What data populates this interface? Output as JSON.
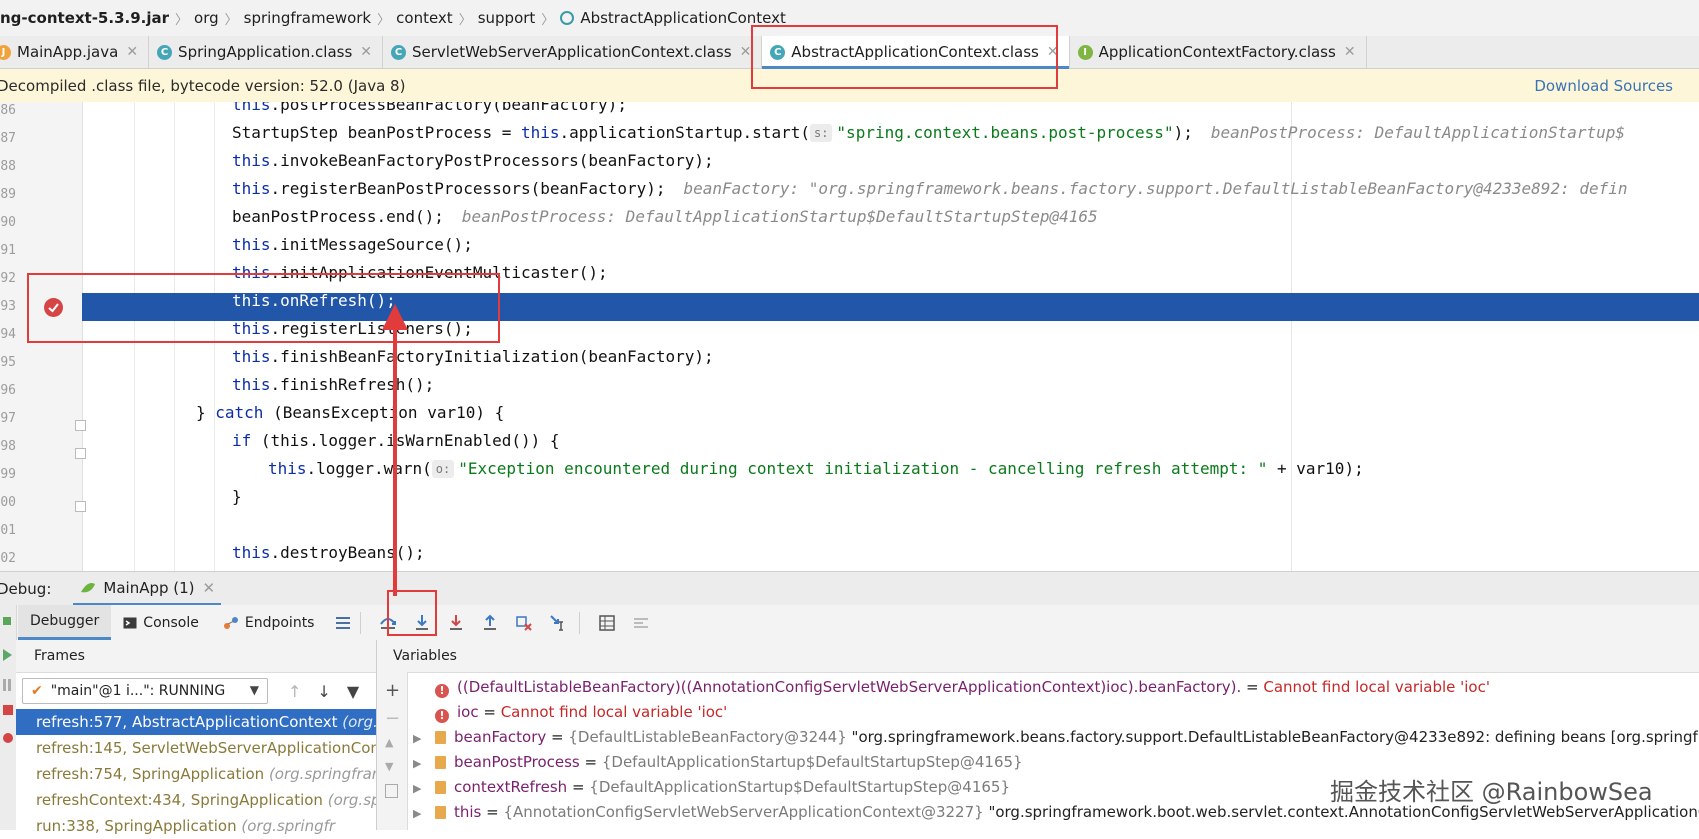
{
  "breadcrumb": {
    "items": [
      "ng-context-5.3.9.jar",
      "org",
      "springframework",
      "context",
      "support",
      "AbstractApplicationContext"
    ]
  },
  "tabs": [
    {
      "label": "MainApp.java",
      "icon": "java-file-icon"
    },
    {
      "label": "SpringApplication.class",
      "icon": "class-file-icon"
    },
    {
      "label": "ServletWebServerApplicationContext.class",
      "icon": "class-file-icon"
    },
    {
      "label": "AbstractApplicationContext.class",
      "icon": "class-file-icon",
      "active": true
    },
    {
      "label": "ApplicationContextFactory.class",
      "icon": "interface-file-icon"
    }
  ],
  "banner": {
    "message": "Decompiled .class file, bytecode version: 52.0 (Java 8)",
    "download": "Download Sources"
  },
  "editor": {
    "line_numbers": [
      "86",
      "87",
      "88",
      "89",
      "90",
      "91",
      "92",
      "93",
      "94",
      "95",
      "96",
      "97",
      "98",
      "99",
      "00",
      "01",
      "02"
    ],
    "lines": [
      {
        "kw": "this",
        "rest": ".postProcessBeanFactory(beanFactory);"
      },
      {
        "pre": "StartupStep beanPostProcess = ",
        "kw": "this",
        "rest": ".applicationStartup.start(",
        "ph": "s:",
        "str": "\"spring.context.beans.post-process\"",
        "post": ");",
        "hint": "beanPostProcess: DefaultApplicationStartup$"
      },
      {
        "kw": "this",
        "rest": ".invokeBeanFactoryPostProcessors(beanFactory);"
      },
      {
        "kw": "this",
        "rest": ".registerBeanPostProcessors(beanFactory);",
        "hint": "beanFactory: \"org.springframework.beans.factory.support.DefaultListableBeanFactory@4233e892: defin"
      },
      {
        "pre": "beanPostProcess.end();",
        "hint": "beanPostProcess: DefaultApplicationStartup$DefaultStartupStep@4165"
      },
      {
        "kw": "this",
        "rest": ".initMessageSource();"
      },
      {
        "kw": "this",
        "rest": ".initApplicationEventMulticaster();"
      },
      {
        "kw": "this",
        "rest": ".onRefresh();"
      },
      {
        "kw": "this",
        "rest": ".registerListeners();"
      },
      {
        "kw": "this",
        "rest": ".finishBeanFactoryInitialization(beanFactory);"
      },
      {
        "kw": "this",
        "rest": ".finishRefresh();"
      },
      {
        "pre": "} ",
        "kw": "catch",
        "rest": " (BeansException var10) {"
      },
      {
        "kw": "if",
        "rest": " (this.logger.isWarnEnabled()) {"
      },
      {
        "kw": "this",
        "rest": ".logger.warn(",
        "ph": "o:",
        "str": "\"Exception encountered during context initialization - cancelling refresh attempt: \"",
        "post": " + var10);"
      },
      {
        "pre": "}"
      },
      {
        "pre": ""
      },
      {
        "kw": "this",
        "rest": ".destroyBeans();"
      }
    ]
  },
  "debug": {
    "label": "Debug:",
    "run_tab": "MainApp (1)",
    "tool_tabs": [
      "Debugger",
      "Console",
      "Endpoints"
    ],
    "frames_title": "Frames",
    "thread": "\"main\"@1 i...\": RUNNING",
    "frames": [
      {
        "method": "refresh:577, AbstractApplicationContext",
        "pkg": "(org.s"
      },
      {
        "method": "refresh:145, ServletWebServerApplicationCont",
        "pkg": ""
      },
      {
        "method": "refresh:754, SpringApplication",
        "pkg": "(org.springfram"
      },
      {
        "method": "refreshContext:434, SpringApplication",
        "pkg": "(org.sp"
      },
      {
        "method": "run:338, SpringApplication",
        "pkg": "(org.springfr"
      }
    ],
    "variables_title": "Variables",
    "variables": [
      {
        "kind": "error",
        "name": "((DefaultListableBeanFactory)((AnnotationConfigServletWebServerApplicationContext)ioc).beanFactory).",
        "eq": " = ",
        "value": "Cannot find local variable 'ioc'"
      },
      {
        "kind": "error",
        "name": "ioc",
        "eq": " = ",
        "value": "Cannot find local variable 'ioc'"
      },
      {
        "kind": "field",
        "name": "beanFactory",
        "eq": " = ",
        "type": "{DefaultListableBeanFactory@3244}",
        "value": " \"org.springframework.beans.factory.support.DefaultListableBeanFactory@4233e892: defining beans [org.springframewo"
      },
      {
        "kind": "field",
        "name": "beanPostProcess",
        "eq": " = ",
        "type": "{DefaultApplicationStartup$DefaultStartupStep@4165}",
        "value": ""
      },
      {
        "kind": "field",
        "name": "contextRefresh",
        "eq": " = ",
        "type": "{DefaultApplicationStartup$DefaultStartupStep@4165}",
        "value": ""
      },
      {
        "kind": "field",
        "name": "this",
        "eq": " = ",
        "type": "{AnnotationConfigServletWebServerApplicationContext@3227}",
        "value": " \"org.springframework.boot.web.servlet.context.AnnotationConfigServletWebServerApplicationCo"
      }
    ]
  },
  "watermark": "掘金技术社区 @RainbowSea",
  "colors": {
    "selection": "#2256a8",
    "annotation": "#e23b3b",
    "keyword": "#0b2ea8",
    "string": "#0a7a1a"
  }
}
